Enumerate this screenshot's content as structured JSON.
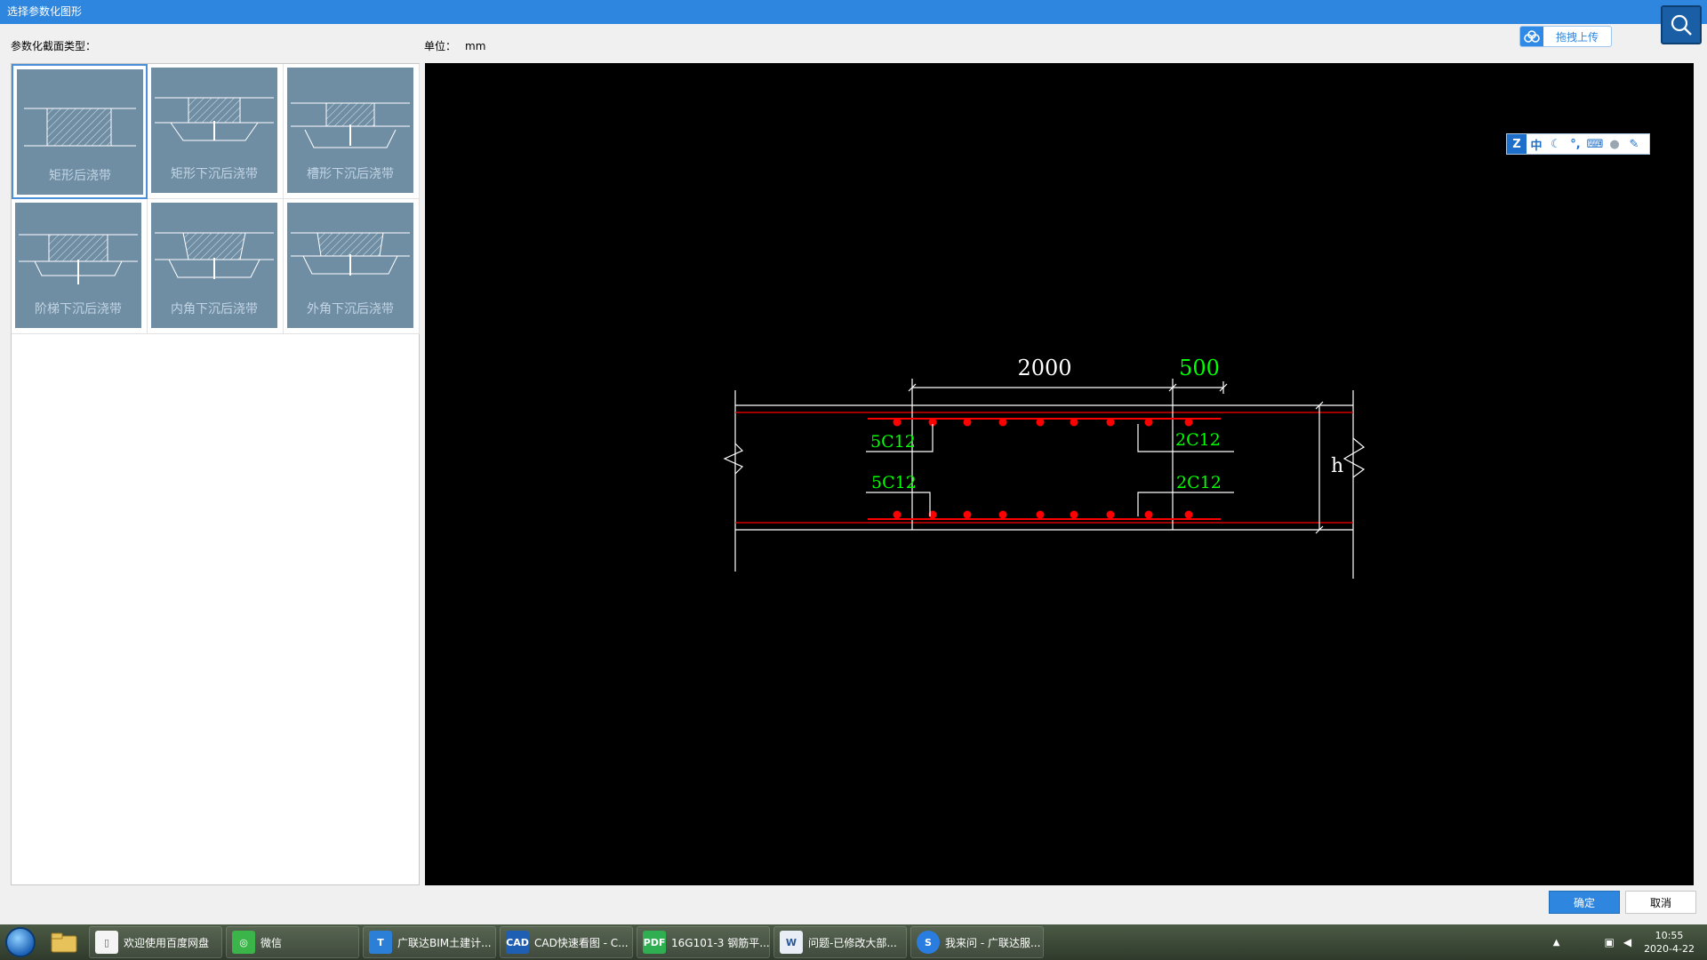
{
  "window": {
    "title": "选择参数化图形"
  },
  "upload": {
    "label": "拖拽上传",
    "icon": "cloud-icon"
  },
  "left": {
    "section_label": "参数化截面类型："
  },
  "unit": {
    "label": "单位：",
    "value": "mm"
  },
  "thumbnails": [
    {
      "label": "矩形后浇带",
      "selected": true
    },
    {
      "label": "矩形下沉后浇带",
      "selected": false
    },
    {
      "label": "槽形下沉后浇带",
      "selected": false
    },
    {
      "label": "阶梯下沉后浇带",
      "selected": false
    },
    {
      "label": "内角下沉后浇带",
      "selected": false
    },
    {
      "label": "外角下沉后浇带",
      "selected": false
    }
  ],
  "drawing": {
    "dim_width": "2000",
    "dim_extend": "500",
    "height_label": "h",
    "rebar_top_left": "5C12",
    "rebar_top_right": "2C12",
    "rebar_bottom_left": "5C12",
    "rebar_bottom_right": "2C12",
    "colors": {
      "line": "#ffffff",
      "rebar": "#ff0000",
      "text_green": "#00ff00",
      "text_white": "#ffffff"
    }
  },
  "ime": {
    "mode_label": "中"
  },
  "buttons": {
    "ok": "确定",
    "cancel": "取消"
  },
  "taskbar": {
    "items": [
      {
        "label": "欢迎使用百度网盘",
        "icon": "document-icon"
      },
      {
        "label": "微信",
        "icon": "wechat-icon"
      },
      {
        "label": "广联达BIM土建计...",
        "icon": "glodon-icon"
      },
      {
        "label": "CAD快速看图 - C...",
        "icon": "cad-icon"
      },
      {
        "label": "16G101-3 钢筋平...",
        "icon": "pdf-icon"
      },
      {
        "label": "问题-已修改大部...",
        "icon": "word-icon"
      },
      {
        "label": "我来问 - 广联达服...",
        "icon": "sogou-icon"
      }
    ],
    "clock_time": "10:55",
    "clock_date": "2020-4-22"
  }
}
